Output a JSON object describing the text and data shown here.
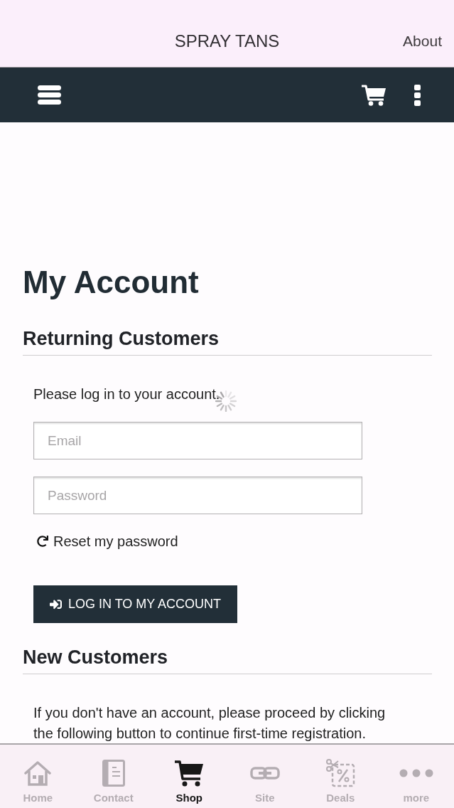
{
  "header": {
    "title": "SPRAY TANS",
    "link": "About"
  },
  "page": {
    "title": "My Account",
    "returning_customers": {
      "heading": "Returning Customers",
      "intro": "Please log in to your account.",
      "loading": true,
      "fields": [
        {
          "placeholder": "Email"
        },
        {
          "placeholder": "Password"
        }
      ],
      "reset_link": "Reset my password",
      "login_button": "LOG IN TO MY ACCOUNT"
    },
    "new_customers": {
      "heading": "New Customers",
      "text": "If you don't have an account, please proceed by clicking the following button to continue first-time registration."
    }
  },
  "tab_bar": [
    {
      "kind": "home",
      "label": "Home",
      "selected": false
    },
    {
      "kind": "contact",
      "label": "Contact",
      "selected": false
    },
    {
      "kind": "shop",
      "label": "Shop",
      "selected": true
    },
    {
      "kind": "site",
      "label": "Site",
      "selected": false
    },
    {
      "kind": "deals",
      "label": "Deals",
      "selected": false
    },
    {
      "kind": "more",
      "label": "more",
      "selected": false
    }
  ]
}
